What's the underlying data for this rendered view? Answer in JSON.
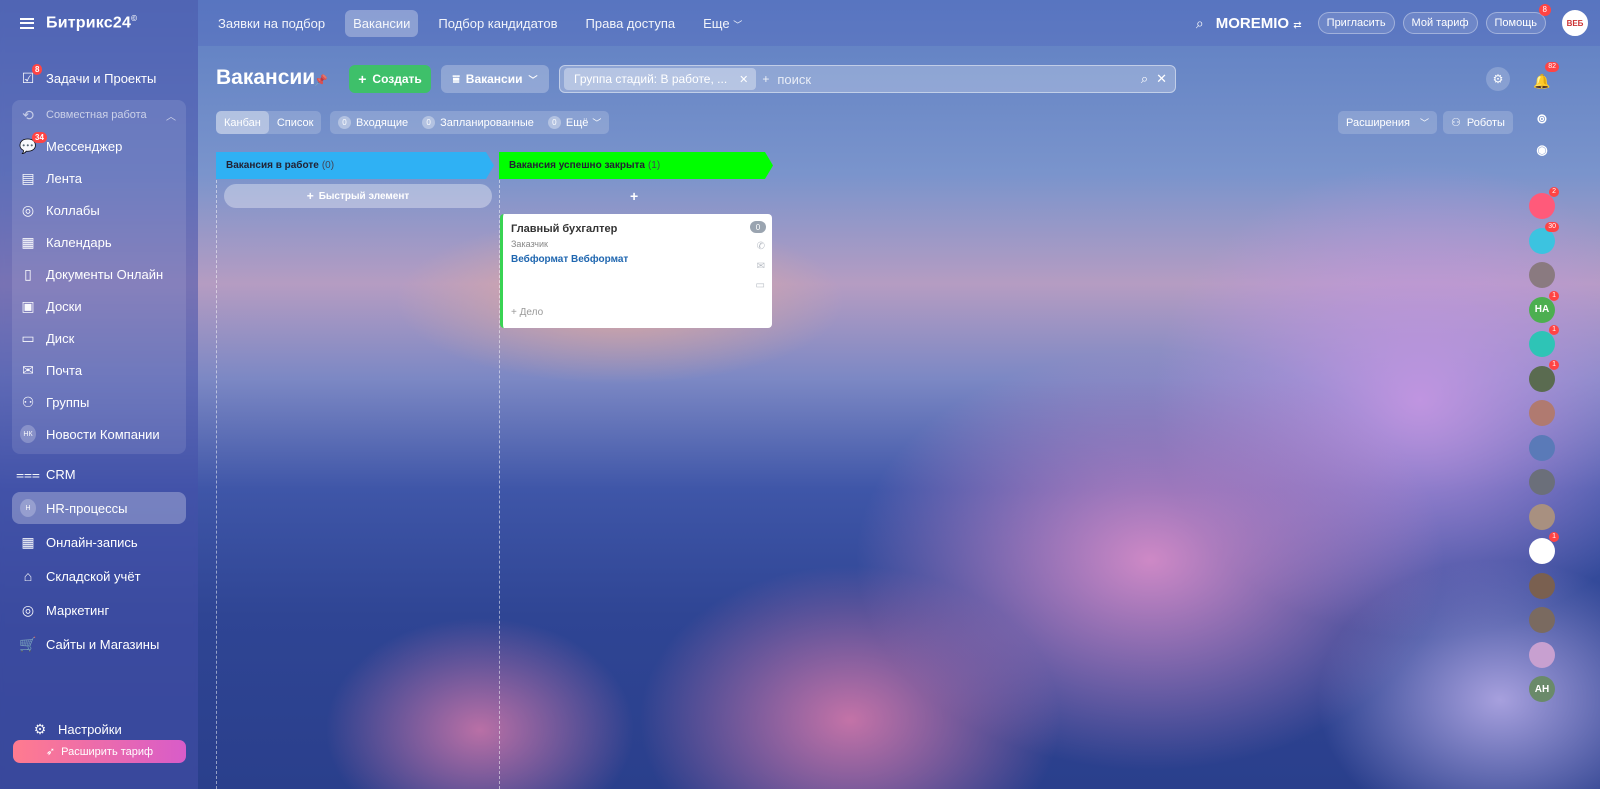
{
  "app": {
    "logo": "Битрикс24",
    "logo_mark": "©"
  },
  "sidebar": {
    "items": [
      {
        "label": "Задачи и Проекты",
        "badge": "8"
      },
      {
        "label": "Совместная работа"
      },
      {
        "label": "Мессенджер",
        "badge": "34"
      },
      {
        "label": "Лента"
      },
      {
        "label": "Коллабы"
      },
      {
        "label": "Календарь"
      },
      {
        "label": "Документы Онлайн"
      },
      {
        "label": "Доски"
      },
      {
        "label": "Диск"
      },
      {
        "label": "Почта"
      },
      {
        "label": "Группы"
      },
      {
        "label": "Новости Компании",
        "abbr": "НК"
      },
      {
        "label": "CRM"
      },
      {
        "label": "HR-процессы",
        "abbr": "Н"
      },
      {
        "label": "Онлайн-запись"
      },
      {
        "label": "Складской учёт"
      },
      {
        "label": "Маркетинг"
      },
      {
        "label": "Сайты и Магазины"
      }
    ],
    "settings": "Настройки",
    "upgrade": "Расширить тариф"
  },
  "topbar": {
    "tabs": [
      "Заявки на подбор",
      "Вакансии",
      "Подбор кандидатов",
      "Права доступа",
      "Еще"
    ],
    "brand": "MOREMIO",
    "invite": "Пригласить",
    "tariff": "Мой тариф",
    "help": "Помощь",
    "help_badge": "8",
    "avatar": "ВЕБ"
  },
  "toolbar": {
    "title": "Вакансии",
    "create": "Создать",
    "category": "Вакансии",
    "filter_chip": "Группа стадий: В работе, ...",
    "search_prefix": "+",
    "search_placeholder": "поиск"
  },
  "subbar": {
    "kanban": "Канбан",
    "list": "Список",
    "incoming_count": "0",
    "incoming": "Входящие",
    "planned_count": "0",
    "planned": "Запланированные",
    "more_count": "0",
    "more": "Ещё",
    "extensions": "Расширения",
    "robots": "Роботы"
  },
  "kanban": {
    "columns": [
      {
        "title": "Вакансия в работе",
        "count": "(0)",
        "color": "#2fb1f4"
      },
      {
        "title": "Вакансия успешно закрыта",
        "count": "(1)",
        "color": "#00ff00"
      }
    ],
    "quick_add": "Быстрый элемент",
    "card": {
      "title": "Главный бухгалтер",
      "sub": "Заказчик",
      "client": "Вебформат Вебформат",
      "counter": "0",
      "activity": "+ Дело"
    }
  },
  "right_bar": {
    "notif_badge": "82",
    "items": [
      {
        "badge": "2",
        "color": "#ff5a7a"
      },
      {
        "badge": "30",
        "color": "#3cc3e0"
      },
      {
        "badge": "",
        "color": "#8a7a80"
      },
      {
        "label": "НА",
        "badge": "1",
        "color": "#4caf50"
      },
      {
        "badge": "1",
        "color": "#2ec4b6"
      },
      {
        "badge": "1",
        "color": "#5a6b50"
      },
      {
        "badge": "",
        "color": "#b07a70"
      },
      {
        "badge": "",
        "color": "#5a7ab8"
      },
      {
        "badge": "",
        "color": "#6b6f7a"
      },
      {
        "badge": "",
        "color": "#a89080"
      },
      {
        "badge": "1",
        "color": "#ffffff"
      },
      {
        "badge": "",
        "color": "#7a6050"
      },
      {
        "badge": "",
        "color": "#7a6a60"
      },
      {
        "badge": "",
        "color": "#c8a0d0"
      },
      {
        "label": "АН",
        "badge": "",
        "color": "#6a8a6a"
      }
    ]
  }
}
